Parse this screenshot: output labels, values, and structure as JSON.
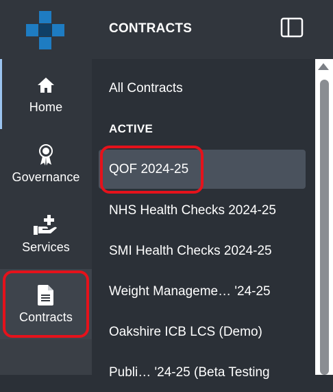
{
  "rail": {
    "items": [
      {
        "label": "Home",
        "icon": "home-icon"
      },
      {
        "label": "Governance",
        "icon": "award-icon"
      },
      {
        "label": "Services",
        "icon": "hand-plus-icon"
      },
      {
        "label": "Contracts",
        "icon": "document-icon"
      }
    ],
    "active": "Contracts"
  },
  "panel": {
    "title": "CONTRACTS",
    "all_contracts": "All Contracts",
    "section_active": "ACTIVE",
    "items": [
      {
        "label": "QOF 2024-25",
        "selected": true
      },
      {
        "label": "NHS Health Checks 2024-25"
      },
      {
        "label": "SMI Health Checks 2024-25"
      },
      {
        "label": "Weight Manageme…  '24-25"
      },
      {
        "label": "Oakshire ICB LCS (Demo)"
      },
      {
        "label": "Publi… '24-25 (Beta Testing"
      }
    ]
  },
  "colors": {
    "accent_blue": "#1e7cc2",
    "annotation_red": "#e5121b",
    "selected_bg": "#4a525d"
  }
}
